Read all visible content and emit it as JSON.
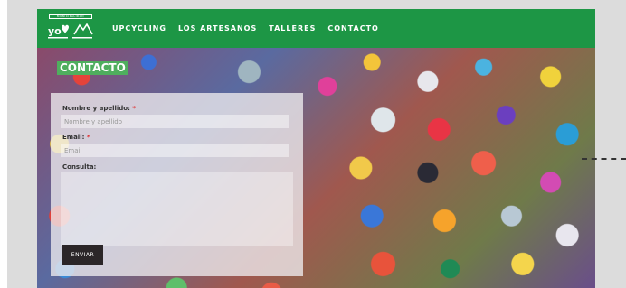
{
  "header": {
    "logo_top_text": "MUNICIPALIDAD",
    "logo_alt": "yo♥ Puerto Montt",
    "nav": [
      {
        "label": "UPCYCLING"
      },
      {
        "label": "LOS ARTESANOS"
      },
      {
        "label": "TALLERES"
      },
      {
        "label": "CONTACTO"
      }
    ]
  },
  "hero": {
    "title": "CONTACTO"
  },
  "form": {
    "name_label": "Nombre y apellido:",
    "name_required": "*",
    "name_placeholder": "Nombre y apellido",
    "email_label": "Email:",
    "email_required": "*",
    "email_placeholder": "Email",
    "message_label": "Consulta:",
    "submit_label": "ENVIAR"
  },
  "colors": {
    "nav_green": "#1d9645",
    "title_green": "#4fae5e",
    "button_dark": "#2b2628"
  }
}
